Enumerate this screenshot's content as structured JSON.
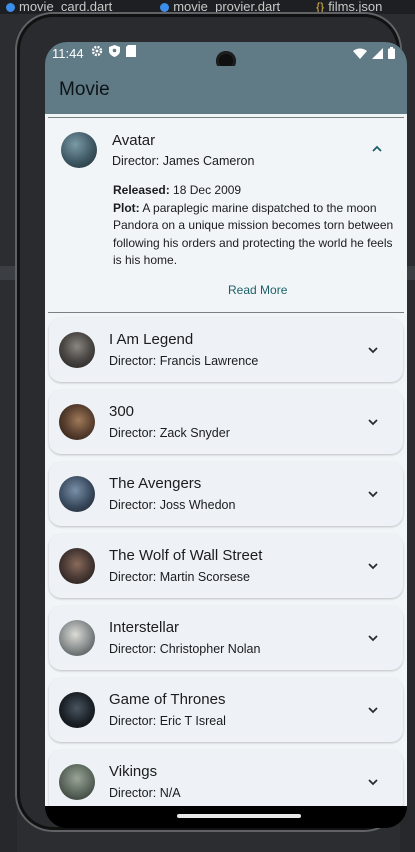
{
  "ide": {
    "tabs": [
      {
        "label": "movie_card.dart"
      },
      {
        "label": "movie_provier.dart"
      },
      {
        "label": "films.json"
      }
    ],
    "json_glyph": "{}"
  },
  "status": {
    "time": "11:44"
  },
  "app": {
    "title": "Movie"
  },
  "movies": [
    {
      "title": "Avatar",
      "director": "Director: James Cameron",
      "expanded": true,
      "released_label": "Released:",
      "released_value": "18 Dec 2009",
      "plot_label": "Plot:",
      "plot_value": "A paraplegic marine dispatched to the moon Pandora on a unique mission becomes torn between following his orders and protecting the world he feels is his home.",
      "read_more": "Read More",
      "avatar_color": "#3e5863"
    },
    {
      "title": "I Am Legend",
      "director": "Director: Francis Lawrence",
      "avatar_color": "#4a4744"
    },
    {
      "title": "300",
      "director": "Director: Zack Snyder",
      "avatar_color": "#5a4030"
    },
    {
      "title": "The Avengers",
      "director": "Director: Joss Whedon",
      "avatar_color": "#3a4a5e"
    },
    {
      "title": "The Wolf of Wall Street",
      "director": "Director: Martin Scorsese",
      "avatar_color": "#4a3a35"
    },
    {
      "title": "Interstellar",
      "director": "Director: Christopher Nolan",
      "avatar_color": "#8a8f90"
    },
    {
      "title": "Game of Thrones",
      "director": "Director: Eric T Isreal",
      "avatar_color": "#1c2228"
    },
    {
      "title": "Vikings",
      "director": "Director: N/A",
      "avatar_color": "#5f6b60"
    }
  ],
  "colors": {
    "app_bar": "#617b86",
    "accent": "#1d6069",
    "background": "#f2f5f8"
  }
}
